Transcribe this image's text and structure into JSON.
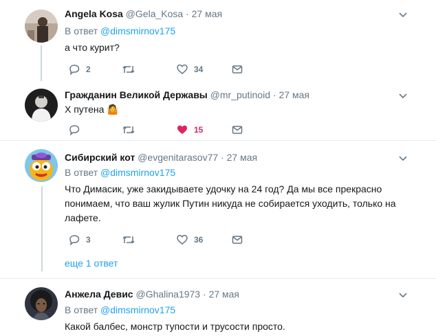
{
  "tweets": [
    {
      "name": "Angela Kosa",
      "handle": "@Gela_Kosa",
      "dot": "·",
      "time": "27 мая",
      "reply_prefix": "В ответ",
      "reply_to": "@dimsmirnov175",
      "text": "а что курит?",
      "replies": "2",
      "retweets": "",
      "likes": "34",
      "liked": false,
      "avatar_icon": "person-photo-icon"
    },
    {
      "name": "Гражданин Великой Державы",
      "handle": "@mr_putinoid",
      "dot": "·",
      "time": "27 мая",
      "text": "Х путена 🤷",
      "replies": "",
      "retweets": "",
      "likes": "15",
      "liked": true,
      "avatar_icon": "person-photo-icon"
    },
    {
      "name": "Сибирский кот",
      "handle": "@evgenitarasov77",
      "dot": "·",
      "time": "27 мая",
      "reply_prefix": "В ответ",
      "reply_to": "@dimsmirnov175",
      "text_line1": "Что Димасик, уже закидываете удочку на 24 год? Да мы все прекрасно",
      "text_line2": "понимаем, что ваш жулик Путин никуда не собирается уходить, только на",
      "text_line3": "лафете.",
      "replies": "3",
      "retweets": "",
      "likes": "36",
      "liked": false,
      "avatar_icon": "cartoon-avatar-icon"
    },
    {
      "name": "Анжела Девис",
      "handle": "@Ghalina1973",
      "dot": "·",
      "time": "27 мая",
      "reply_prefix": "В ответ",
      "reply_to": "@dimsmirnov175",
      "text": "Какой балбес, монстр тупости и трусости просто.",
      "avatar_icon": "person-photo-icon"
    }
  ],
  "more_replies": "еще 1 ответ",
  "colors": {
    "accent": "#1da1f2",
    "like": "#e0245e",
    "muted": "#657786",
    "divider": "#e6ecf0"
  }
}
